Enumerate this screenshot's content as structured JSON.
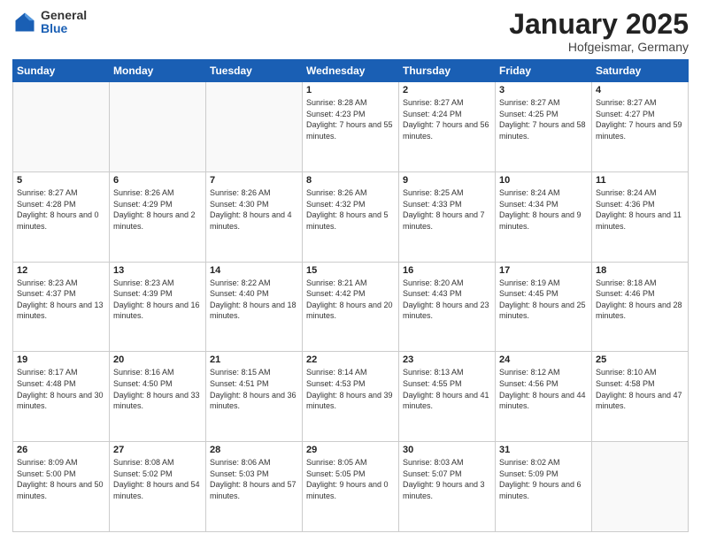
{
  "logo": {
    "general": "General",
    "blue": "Blue"
  },
  "header": {
    "title": "January 2025",
    "subtitle": "Hofgeismar, Germany"
  },
  "weekdays": [
    "Sunday",
    "Monday",
    "Tuesday",
    "Wednesday",
    "Thursday",
    "Friday",
    "Saturday"
  ],
  "weeks": [
    [
      {
        "day": "",
        "sunrise": "",
        "sunset": "",
        "daylight": ""
      },
      {
        "day": "",
        "sunrise": "",
        "sunset": "",
        "daylight": ""
      },
      {
        "day": "",
        "sunrise": "",
        "sunset": "",
        "daylight": ""
      },
      {
        "day": "1",
        "sunrise": "Sunrise: 8:28 AM",
        "sunset": "Sunset: 4:23 PM",
        "daylight": "Daylight: 7 hours and 55 minutes."
      },
      {
        "day": "2",
        "sunrise": "Sunrise: 8:27 AM",
        "sunset": "Sunset: 4:24 PM",
        "daylight": "Daylight: 7 hours and 56 minutes."
      },
      {
        "day": "3",
        "sunrise": "Sunrise: 8:27 AM",
        "sunset": "Sunset: 4:25 PM",
        "daylight": "Daylight: 7 hours and 58 minutes."
      },
      {
        "day": "4",
        "sunrise": "Sunrise: 8:27 AM",
        "sunset": "Sunset: 4:27 PM",
        "daylight": "Daylight: 7 hours and 59 minutes."
      }
    ],
    [
      {
        "day": "5",
        "sunrise": "Sunrise: 8:27 AM",
        "sunset": "Sunset: 4:28 PM",
        "daylight": "Daylight: 8 hours and 0 minutes."
      },
      {
        "day": "6",
        "sunrise": "Sunrise: 8:26 AM",
        "sunset": "Sunset: 4:29 PM",
        "daylight": "Daylight: 8 hours and 2 minutes."
      },
      {
        "day": "7",
        "sunrise": "Sunrise: 8:26 AM",
        "sunset": "Sunset: 4:30 PM",
        "daylight": "Daylight: 8 hours and 4 minutes."
      },
      {
        "day": "8",
        "sunrise": "Sunrise: 8:26 AM",
        "sunset": "Sunset: 4:32 PM",
        "daylight": "Daylight: 8 hours and 5 minutes."
      },
      {
        "day": "9",
        "sunrise": "Sunrise: 8:25 AM",
        "sunset": "Sunset: 4:33 PM",
        "daylight": "Daylight: 8 hours and 7 minutes."
      },
      {
        "day": "10",
        "sunrise": "Sunrise: 8:24 AM",
        "sunset": "Sunset: 4:34 PM",
        "daylight": "Daylight: 8 hours and 9 minutes."
      },
      {
        "day": "11",
        "sunrise": "Sunrise: 8:24 AM",
        "sunset": "Sunset: 4:36 PM",
        "daylight": "Daylight: 8 hours and 11 minutes."
      }
    ],
    [
      {
        "day": "12",
        "sunrise": "Sunrise: 8:23 AM",
        "sunset": "Sunset: 4:37 PM",
        "daylight": "Daylight: 8 hours and 13 minutes."
      },
      {
        "day": "13",
        "sunrise": "Sunrise: 8:23 AM",
        "sunset": "Sunset: 4:39 PM",
        "daylight": "Daylight: 8 hours and 16 minutes."
      },
      {
        "day": "14",
        "sunrise": "Sunrise: 8:22 AM",
        "sunset": "Sunset: 4:40 PM",
        "daylight": "Daylight: 8 hours and 18 minutes."
      },
      {
        "day": "15",
        "sunrise": "Sunrise: 8:21 AM",
        "sunset": "Sunset: 4:42 PM",
        "daylight": "Daylight: 8 hours and 20 minutes."
      },
      {
        "day": "16",
        "sunrise": "Sunrise: 8:20 AM",
        "sunset": "Sunset: 4:43 PM",
        "daylight": "Daylight: 8 hours and 23 minutes."
      },
      {
        "day": "17",
        "sunrise": "Sunrise: 8:19 AM",
        "sunset": "Sunset: 4:45 PM",
        "daylight": "Daylight: 8 hours and 25 minutes."
      },
      {
        "day": "18",
        "sunrise": "Sunrise: 8:18 AM",
        "sunset": "Sunset: 4:46 PM",
        "daylight": "Daylight: 8 hours and 28 minutes."
      }
    ],
    [
      {
        "day": "19",
        "sunrise": "Sunrise: 8:17 AM",
        "sunset": "Sunset: 4:48 PM",
        "daylight": "Daylight: 8 hours and 30 minutes."
      },
      {
        "day": "20",
        "sunrise": "Sunrise: 8:16 AM",
        "sunset": "Sunset: 4:50 PM",
        "daylight": "Daylight: 8 hours and 33 minutes."
      },
      {
        "day": "21",
        "sunrise": "Sunrise: 8:15 AM",
        "sunset": "Sunset: 4:51 PM",
        "daylight": "Daylight: 8 hours and 36 minutes."
      },
      {
        "day": "22",
        "sunrise": "Sunrise: 8:14 AM",
        "sunset": "Sunset: 4:53 PM",
        "daylight": "Daylight: 8 hours and 39 minutes."
      },
      {
        "day": "23",
        "sunrise": "Sunrise: 8:13 AM",
        "sunset": "Sunset: 4:55 PM",
        "daylight": "Daylight: 8 hours and 41 minutes."
      },
      {
        "day": "24",
        "sunrise": "Sunrise: 8:12 AM",
        "sunset": "Sunset: 4:56 PM",
        "daylight": "Daylight: 8 hours and 44 minutes."
      },
      {
        "day": "25",
        "sunrise": "Sunrise: 8:10 AM",
        "sunset": "Sunset: 4:58 PM",
        "daylight": "Daylight: 8 hours and 47 minutes."
      }
    ],
    [
      {
        "day": "26",
        "sunrise": "Sunrise: 8:09 AM",
        "sunset": "Sunset: 5:00 PM",
        "daylight": "Daylight: 8 hours and 50 minutes."
      },
      {
        "day": "27",
        "sunrise": "Sunrise: 8:08 AM",
        "sunset": "Sunset: 5:02 PM",
        "daylight": "Daylight: 8 hours and 54 minutes."
      },
      {
        "day": "28",
        "sunrise": "Sunrise: 8:06 AM",
        "sunset": "Sunset: 5:03 PM",
        "daylight": "Daylight: 8 hours and 57 minutes."
      },
      {
        "day": "29",
        "sunrise": "Sunrise: 8:05 AM",
        "sunset": "Sunset: 5:05 PM",
        "daylight": "Daylight: 9 hours and 0 minutes."
      },
      {
        "day": "30",
        "sunrise": "Sunrise: 8:03 AM",
        "sunset": "Sunset: 5:07 PM",
        "daylight": "Daylight: 9 hours and 3 minutes."
      },
      {
        "day": "31",
        "sunrise": "Sunrise: 8:02 AM",
        "sunset": "Sunset: 5:09 PM",
        "daylight": "Daylight: 9 hours and 6 minutes."
      },
      {
        "day": "",
        "sunrise": "",
        "sunset": "",
        "daylight": ""
      }
    ]
  ]
}
